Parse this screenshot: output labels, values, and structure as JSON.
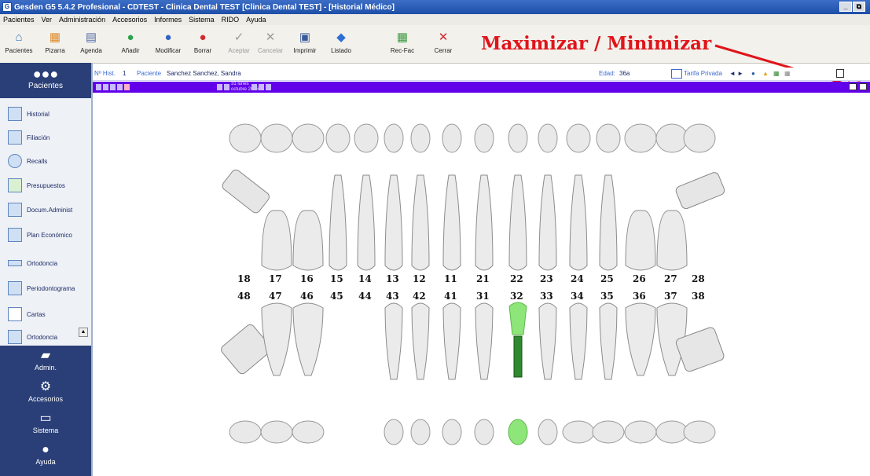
{
  "window": {
    "title": "Gesden G5 5.4.2 Profesional - CDTEST - Clinica Dental TEST [Clinica Dental TEST] - [Historial Médico]",
    "controls": [
      "_",
      "⧉"
    ]
  },
  "menu": [
    "Pacientes",
    "Ver",
    "Administración",
    "Accesorios",
    "Informes",
    "Sistema",
    "RIDO",
    "Ayuda"
  ],
  "toolbar": [
    {
      "label": "Pacientes",
      "icon": "patients-icon",
      "glyph": "⌂",
      "color": "#3c78c3",
      "enabled": true
    },
    {
      "label": "Pizarra",
      "icon": "board-icon",
      "glyph": "▦",
      "color": "#e08a2a",
      "enabled": true
    },
    {
      "label": "Agenda",
      "icon": "agenda-icon",
      "glyph": "▤",
      "color": "#5a6fa8",
      "enabled": true
    },
    {
      "label": "Añadir",
      "icon": "add-icon",
      "glyph": "●",
      "color": "#2ba24c",
      "enabled": true
    },
    {
      "label": "Modificar",
      "icon": "edit-icon",
      "glyph": "●",
      "color": "#2f63c4",
      "enabled": true
    },
    {
      "label": "Borrar",
      "icon": "delete-icon",
      "glyph": "●",
      "color": "#d1292f",
      "enabled": true
    },
    {
      "label": "Aceptar",
      "icon": "check-icon",
      "glyph": "✓",
      "color": "#9a9a9a",
      "enabled": false
    },
    {
      "label": "Cancelar",
      "icon": "cancel-icon",
      "glyph": "✕",
      "color": "#9a9a9a",
      "enabled": false
    },
    {
      "label": "Imprimir",
      "icon": "printer-icon",
      "glyph": "▣",
      "color": "#3a5a9a",
      "enabled": true
    },
    {
      "label": "Listado",
      "icon": "list-icon",
      "glyph": "◆",
      "color": "#2c6fd6",
      "enabled": true
    },
    {
      "label": "Rec-Fac",
      "icon": "receipt-icon",
      "glyph": "▦",
      "color": "#3e9a3e",
      "enabled": true
    },
    {
      "label": "Cerrar",
      "icon": "close-icon",
      "glyph": "✕",
      "color": "#d1292f",
      "enabled": true
    }
  ],
  "annotation": {
    "text": "Maximizar / Minimizar",
    "color": "#e0141a"
  },
  "sidebar": {
    "header": "Pacientes",
    "items": [
      "Historial",
      "Filiación",
      "Recalls",
      "Presupuestos",
      "Docum.Administ",
      "Plan Económico",
      "Ortodoncia",
      "Periodontograma",
      "Cartas",
      "Ortodoncia"
    ],
    "sections": [
      "Admin.",
      "Accesorios",
      "Sistema",
      "Ayuda"
    ]
  },
  "patient": {
    "record_label": "Nº Hist.",
    "record": "1",
    "patient_label": "Paciente",
    "name": "Sanchez Sanchez, Sandra",
    "age_label": "Edad:",
    "age": "36a",
    "tariff": "Tarifa Privada"
  },
  "date": {
    "line1": "31 lunes",
    "line2": "octubre 2016"
  },
  "chart": {
    "upper_numbers": [
      "18",
      "17",
      "16",
      "15",
      "14",
      "13",
      "12",
      "11",
      "21",
      "22",
      "23",
      "24",
      "25",
      "26",
      "27",
      "28"
    ],
    "lower_numbers": [
      "48",
      "47",
      "46",
      "45",
      "44",
      "43",
      "42",
      "41",
      "31",
      "32",
      "33",
      "34",
      "35",
      "36",
      "37",
      "38"
    ],
    "highlight_tooth": "32",
    "highlight_color": "#8ee57a"
  }
}
